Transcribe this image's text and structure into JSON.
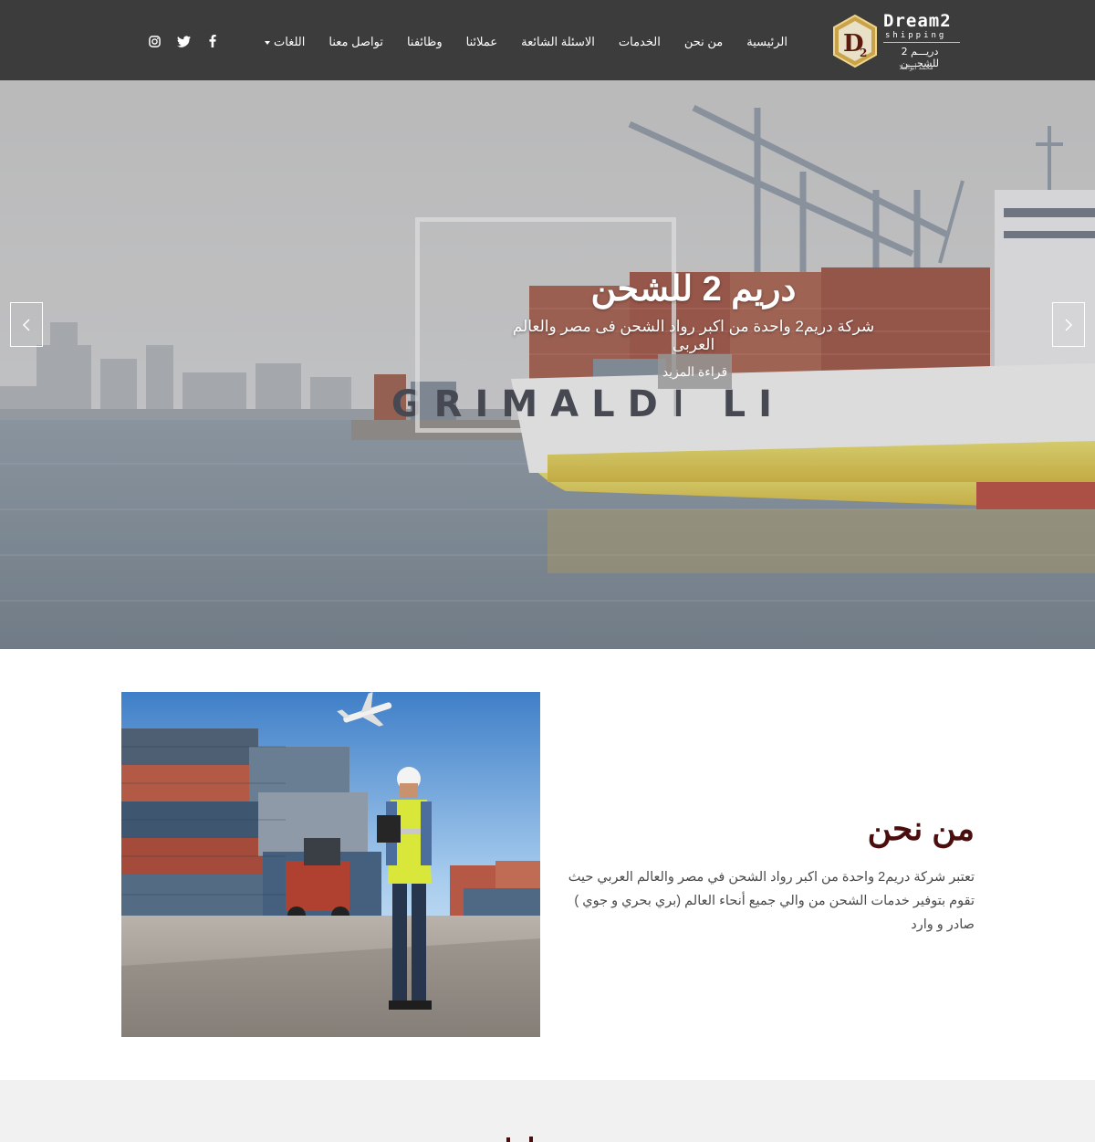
{
  "brand": {
    "name_en": "Dream2",
    "tagline_en": "shipping",
    "name_ar": "دريـــم 2 للشحـــن",
    "owner": "محمد أبوالعلا",
    "badge_letters": "D2"
  },
  "nav": {
    "items": [
      {
        "label": "الرئيسية"
      },
      {
        "label": "من نحن"
      },
      {
        "label": "الخدمات"
      },
      {
        "label": "الاسئلة الشائعة"
      },
      {
        "label": "عملائنا"
      },
      {
        "label": "وظائفنا"
      },
      {
        "label": "تواصل معنا"
      },
      {
        "label": "اللغات"
      }
    ],
    "social": [
      "facebook-icon",
      "twitter-icon",
      "instagram-icon"
    ]
  },
  "hero": {
    "title": "دريم 2 للشحن",
    "subtitle": "شركة دريم2 واحدة من اكبر رواد الشحن فى مصر والعالم العربى",
    "button": "قراءة المزيد",
    "ship_text": "GRIMALDI LI"
  },
  "about": {
    "title": "من نحن",
    "text": "تعتبر شركة دريم2 واحدة من اكبر رواد الشحن في مصر والعالم العربي حيث تقوم بتوفير خدمات الشحن من والي جميع أنحاء العالم (بري بحري و جوي ) صادر و وارد"
  },
  "colors": {
    "navbar": "#3c3c3c",
    "about_title": "#4a0e0e",
    "footer_band": "#f1f1f1"
  }
}
